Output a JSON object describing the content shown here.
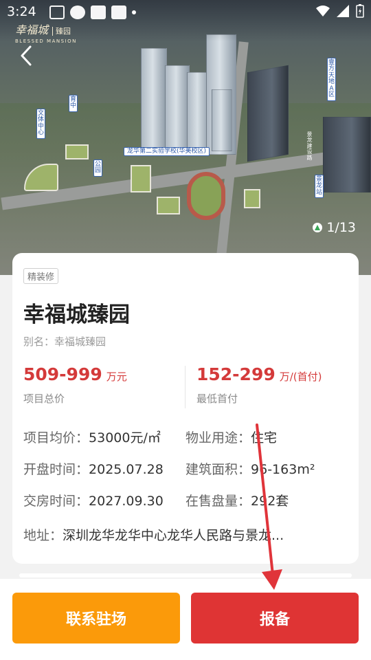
{
  "status_bar": {
    "time": "3:24"
  },
  "brand": {
    "name_cn": "幸福城",
    "name_cn_sub": "臻园",
    "name_en": "BLESSED MANSION"
  },
  "hero": {
    "counter": "1/13",
    "labels": {
      "culture_center": "文体中心",
      "school_middle": "育中",
      "park": "公园",
      "primary_school": "龙华第二实验学校(华美校区)",
      "wanxiang": "壹方天地A区",
      "jinglong": "景龙站",
      "jinglong_road": "景龙建设路"
    }
  },
  "project": {
    "tag": "精装修",
    "title": "幸福城臻园",
    "alias": "别名：幸福城臻园",
    "total_price": {
      "value": "509-999",
      "unit": "万元",
      "label": "项目总价"
    },
    "down_payment": {
      "value": "152-299",
      "unit": "万/(首付)",
      "label": "最低首付"
    },
    "info": {
      "avg_price_label": "项目均价：",
      "avg_price": "53000元/㎡",
      "usage_label": "物业用途：",
      "usage": "住宅",
      "open_label": "开盘时间：",
      "open_date": "2025.07.28",
      "area_label": "建筑面积：",
      "area": "96-163m²",
      "delivery_label": "交房时间：",
      "delivery_date": "2027.09.30",
      "stock_label": "在售盘量：",
      "stock": "292套",
      "address_label": "地址：",
      "address": "深圳龙华龙华中心龙华人民路与景龙..."
    }
  },
  "actions": {
    "contact": "联系驻场",
    "report": "报备"
  },
  "colors": {
    "primary_red": "#df3434",
    "orange": "#fb9a0a",
    "price_red": "#d43a3a"
  }
}
